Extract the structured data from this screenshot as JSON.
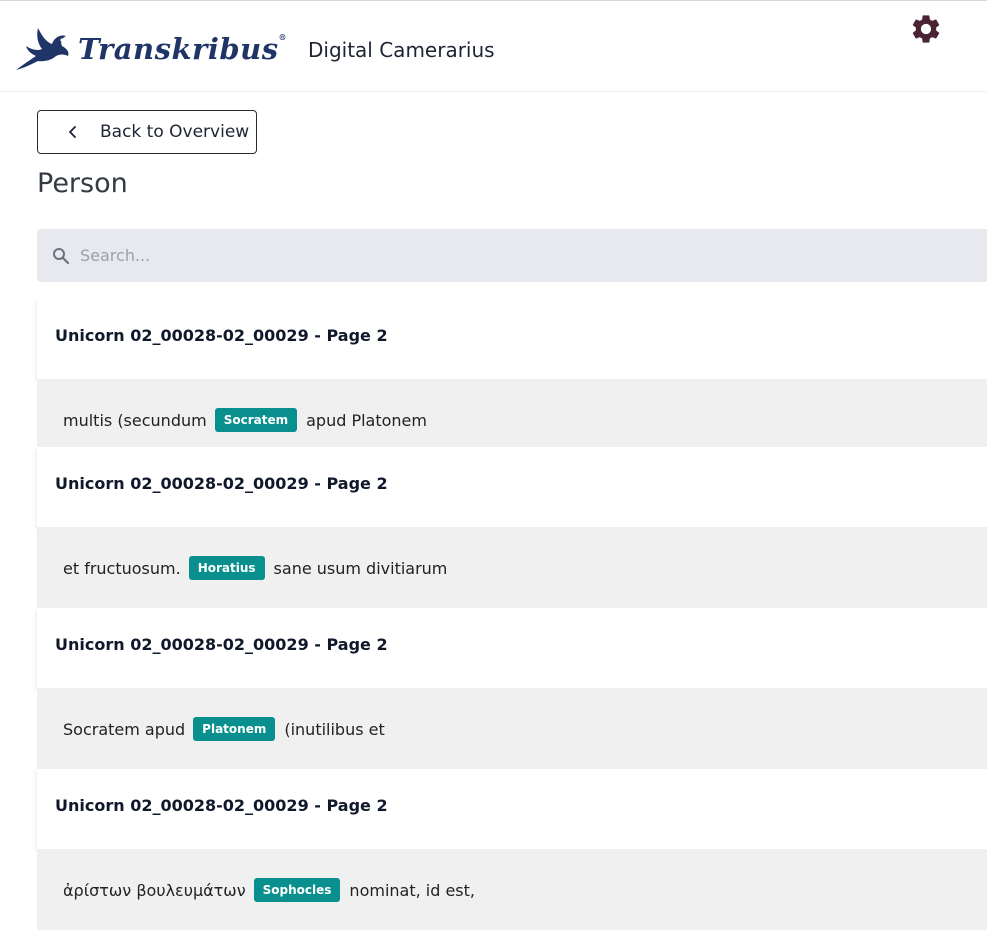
{
  "header": {
    "logo_text": "Transkribus",
    "logo_reg": "®",
    "app_title": "Digital Camerarius"
  },
  "icons": {
    "logo": "flying-creature-logo",
    "settings": "gear-icon",
    "back": "chevron-left-icon",
    "search": "search-icon"
  },
  "colors": {
    "brand": "#1f3568",
    "gear": "#4a2435",
    "tag": "#0a8f8f",
    "search_bg": "#e7e9ef",
    "snippet_bg": "#f0f0f0"
  },
  "nav": {
    "back_label": "Back to Overview"
  },
  "page": {
    "title": "Person"
  },
  "search": {
    "placeholder": "Search..."
  },
  "results": [
    {
      "title": "Unicorn 02_00028-02_00029 - Page 2",
      "before": "multis (secundum",
      "tag": "Socratem",
      "after": "apud Platonem"
    },
    {
      "title": "Unicorn 02_00028-02_00029 - Page 2",
      "before": "et fructuosum.",
      "tag": "Horatius",
      "after": "sane usum divitiarum"
    },
    {
      "title": "Unicorn 02_00028-02_00029 - Page 2",
      "before": "Socratem apud",
      "tag": "Platonem",
      "after": "(inutilibus et"
    },
    {
      "title": "Unicorn 02_00028-02_00029 - Page 2",
      "before": "ἀρίστων βουλευμάτων",
      "tag": "Sophocles",
      "after": "nominat, id est,"
    }
  ]
}
